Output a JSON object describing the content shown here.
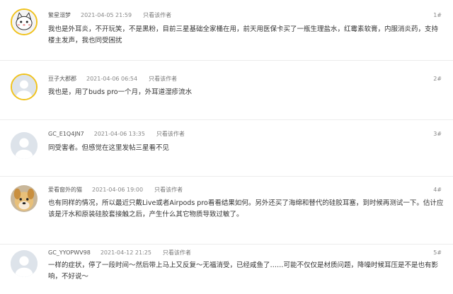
{
  "posts": [
    {
      "username": "繁星溺梦",
      "time": "2021-04-05 21:59",
      "only_author": "只看该作者",
      "floor": "1#",
      "avatar": "cat-avatar-icon",
      "content": "我也是外耳炎，不开玩笑，不是黑粉，目前三星基础全家桶在用，前天用医保卡买了一瓶生理盐水，红霉素软膏，内服消炎药，支持楼主发声，我也同受困扰"
    },
    {
      "username": "豆子大郡郡",
      "time": "2021-04-06 06:54",
      "only_author": "只看该作者",
      "floor": "2#",
      "avatar": "default-user-avatar-icon",
      "content": "我也是，用了buds pro一个月，外耳道湿疹流水"
    },
    {
      "username": "GC_E1Q4JN7",
      "time": "2021-04-06 13:35",
      "only_author": "只看该作者",
      "floor": "3#",
      "avatar": "default-user-avatar-icon",
      "content": "同受害者。但感觉在这里发帖三星看不见"
    },
    {
      "username": "爱看窗外的猫",
      "time": "2021-04-06 19:00",
      "only_author": "只看该作者",
      "floor": "4#",
      "avatar": "dog-avatar-icon",
      "content": "也有同样的情况，所以最近只戴Live或者Airpods pro看看结果如何。另外还买了海绵和替代的硅胶耳塞，到时候再测试一下。估计应该是汗水和原装硅胶套接触之后，产生什么其它物质导致过敏了。"
    },
    {
      "username": "GC_YYOPWV98",
      "time": "2021-04-12 21:25",
      "only_author": "只看该作者",
      "floor": "5#",
      "avatar": "default-user-avatar-icon",
      "content": "一样的症状，停了一段时间～然后带上马上又反复～无福消受，已经咸鱼了……可能不仅仅是材质问题，降噪时候耳压是不是也有影响，不好说～"
    }
  ]
}
